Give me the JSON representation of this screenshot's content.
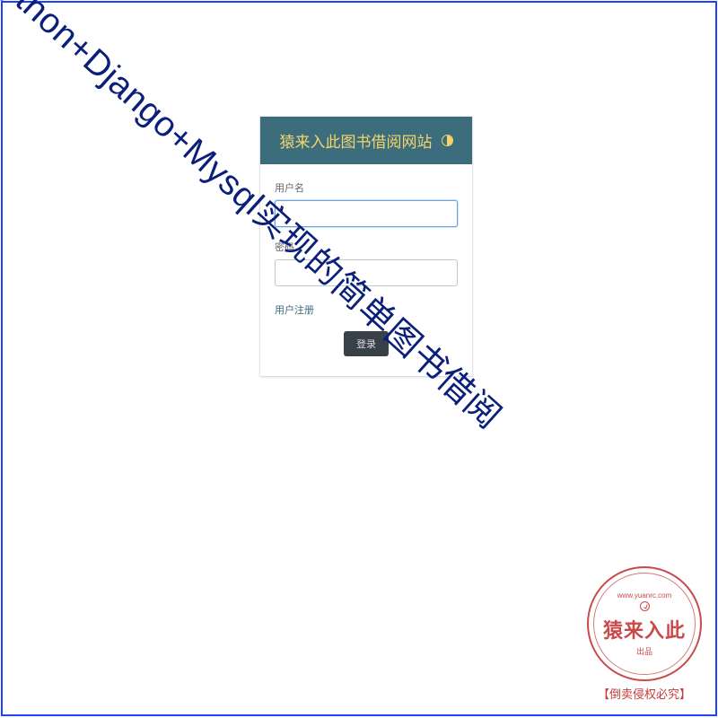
{
  "header": {
    "title": "猿来入此图书借阅网站"
  },
  "form": {
    "username": {
      "label": "用户名",
      "value": "",
      "placeholder": ""
    },
    "password": {
      "label": "密码",
      "value": "",
      "placeholder": ""
    },
    "register_link": "用户注册",
    "submit_label": "登录"
  },
  "watermark": {
    "diagonal_text": "Python+Django+Mysql实现的简单图书借阅"
  },
  "stamp": {
    "url": "www.yuanrc.com",
    "main": "猿来入此",
    "sub": "出品",
    "footer": "【倒卖侵权必究】"
  }
}
